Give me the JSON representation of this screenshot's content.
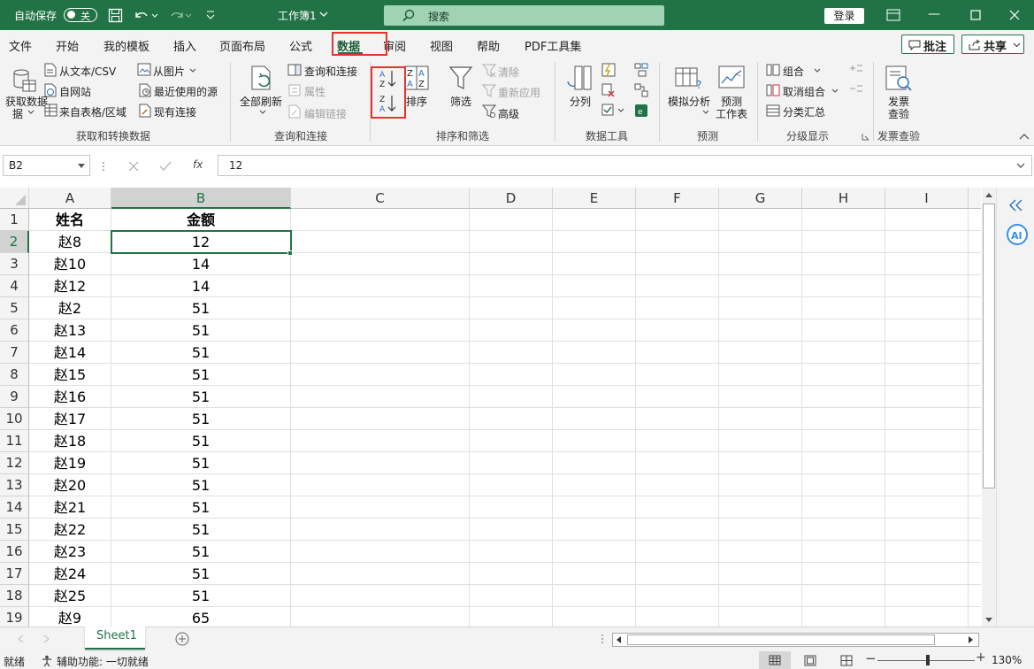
{
  "titlebar": {
    "autosave_label": "自动保存",
    "autosave_state": "关",
    "doc_title": "工作簿1",
    "search_placeholder": "搜索",
    "login": "登录"
  },
  "tabs": [
    "文件",
    "开始",
    "我的模板",
    "插入",
    "页面布局",
    "公式",
    "数据",
    "审阅",
    "视图",
    "帮助",
    "PDF工具集"
  ],
  "active_tab": "数据",
  "right_buttons": {
    "comment": "批注",
    "share": "共享"
  },
  "ribbon": {
    "get_data": {
      "big": "获取数据",
      "big2": "据",
      "items": [
        "从文本/CSV",
        "自网站",
        "来自表格/区域",
        "从图片",
        "最近使用的源",
        "现有连接"
      ],
      "label": "获取和转换数据"
    },
    "queries": {
      "big": "全部刷新",
      "items": [
        "查询和连接",
        "属性",
        "编辑链接"
      ],
      "label": "查询和连接"
    },
    "sort": {
      "sort_label": "排序",
      "filter_label": "筛选",
      "items": [
        "清除",
        "重新应用",
        "高级"
      ],
      "label": "排序和筛选"
    },
    "tools": {
      "split": "分列",
      "label": "数据工具"
    },
    "forecast": {
      "whatif": "模拟分析",
      "sheet1": "预测",
      "sheet2": "工作表",
      "label": "预测"
    },
    "outline": {
      "items": [
        "组合",
        "取消组合",
        "分类汇总"
      ],
      "label": "分级显示"
    },
    "invoice": {
      "btn1": "发票",
      "btn2": "查验",
      "label": "发票查验"
    }
  },
  "formula_bar": {
    "name_box": "B2",
    "value": "12",
    "fx": "fx"
  },
  "columns": [
    "A",
    "B",
    "C",
    "D",
    "E",
    "F",
    "G",
    "H",
    "I"
  ],
  "rows": [
    {
      "n": "1",
      "a": "姓名",
      "b": "金额"
    },
    {
      "n": "2",
      "a": "赵8",
      "b": "12"
    },
    {
      "n": "3",
      "a": "赵10",
      "b": "14"
    },
    {
      "n": "4",
      "a": "赵12",
      "b": "14"
    },
    {
      "n": "5",
      "a": "赵2",
      "b": "51"
    },
    {
      "n": "6",
      "a": "赵13",
      "b": "51"
    },
    {
      "n": "7",
      "a": "赵14",
      "b": "51"
    },
    {
      "n": "8",
      "a": "赵15",
      "b": "51"
    },
    {
      "n": "9",
      "a": "赵16",
      "b": "51"
    },
    {
      "n": "10",
      "a": "赵17",
      "b": "51"
    },
    {
      "n": "11",
      "a": "赵18",
      "b": "51"
    },
    {
      "n": "12",
      "a": "赵19",
      "b": "51"
    },
    {
      "n": "13",
      "a": "赵20",
      "b": "51"
    },
    {
      "n": "14",
      "a": "赵21",
      "b": "51"
    },
    {
      "n": "15",
      "a": "赵22",
      "b": "51"
    },
    {
      "n": "16",
      "a": "赵23",
      "b": "51"
    },
    {
      "n": "17",
      "a": "赵24",
      "b": "51"
    },
    {
      "n": "18",
      "a": "赵25",
      "b": "51"
    },
    {
      "n": "19",
      "a": "赵9",
      "b": "65"
    }
  ],
  "sheet_tab": "Sheet1",
  "status": {
    "ready": "就绪",
    "accessibility": "辅助功能: 一切就绪",
    "zoom": "130%"
  },
  "colors": {
    "brand": "#217346",
    "highlight": "#e4342d"
  }
}
